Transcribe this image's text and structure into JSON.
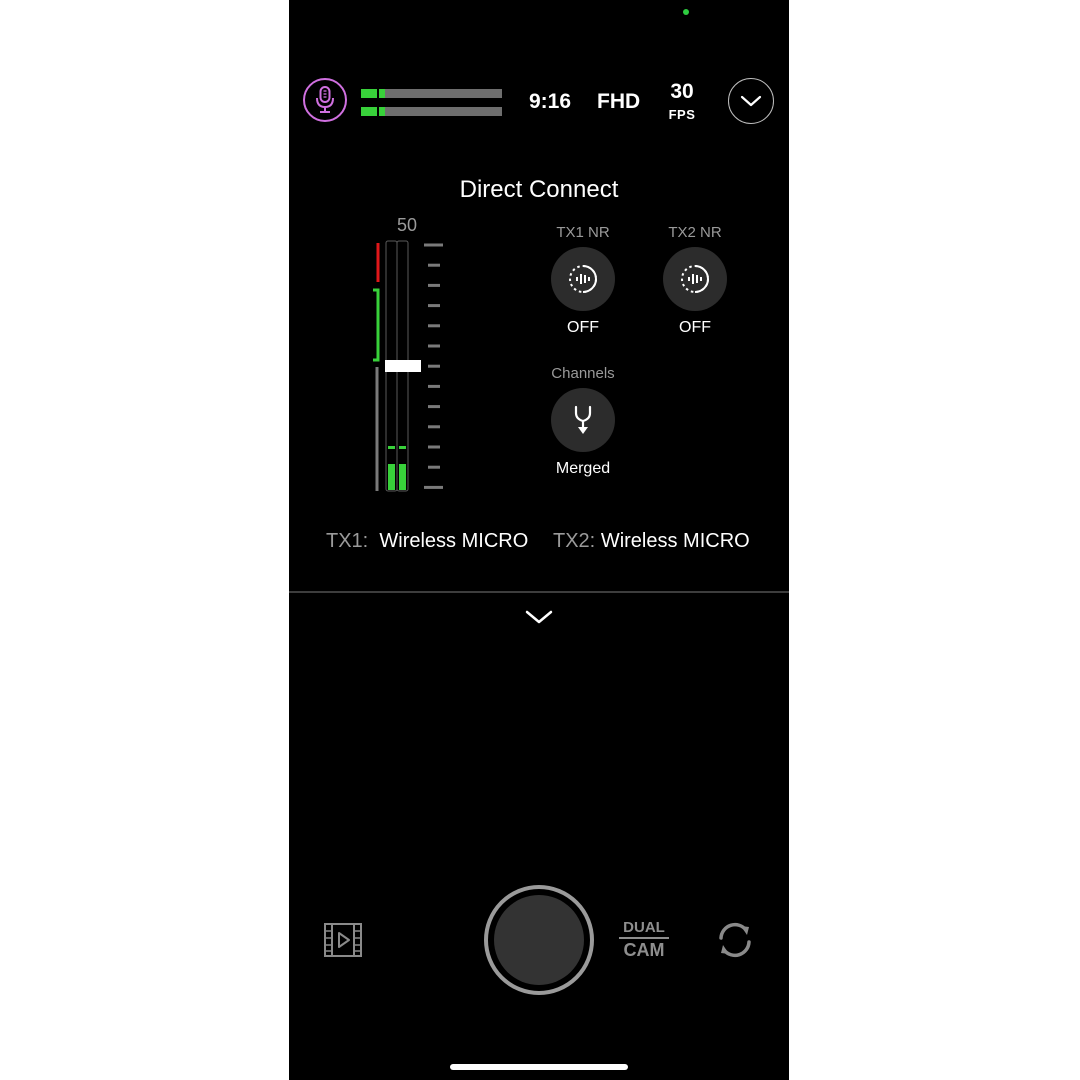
{
  "status": {
    "resolution_time": "9:16",
    "quality": "FHD",
    "fps_value": "30",
    "fps_label": "FPS"
  },
  "audio_levels": {
    "channel1": 0.14,
    "channel2": 0.14
  },
  "panel": {
    "title": "Direct Connect",
    "gain_value": "50",
    "gain_level": 0.5,
    "tx1_nr": {
      "label": "TX1 NR",
      "value": "OFF"
    },
    "tx2_nr": {
      "label": "TX2 NR",
      "value": "OFF"
    },
    "channels": {
      "label": "Channels",
      "value": "Merged"
    },
    "tx1": {
      "key": "TX1:",
      "name": "Wireless MICRO"
    },
    "tx2": {
      "key": "TX2:",
      "name": "Wireless MICRO"
    }
  },
  "bottom": {
    "dual_line1": "DUAL",
    "dual_line2": "CAM"
  },
  "colors": {
    "mic_accent": "#d070e0",
    "meter_green": "#38d13a",
    "clip_red": "#e0171a"
  },
  "icons": [
    "microphone-icon",
    "chevron-down-icon",
    "noise-reduction-icon",
    "merge-channels-icon",
    "video-gallery-icon",
    "camera-flip-icon"
  ]
}
